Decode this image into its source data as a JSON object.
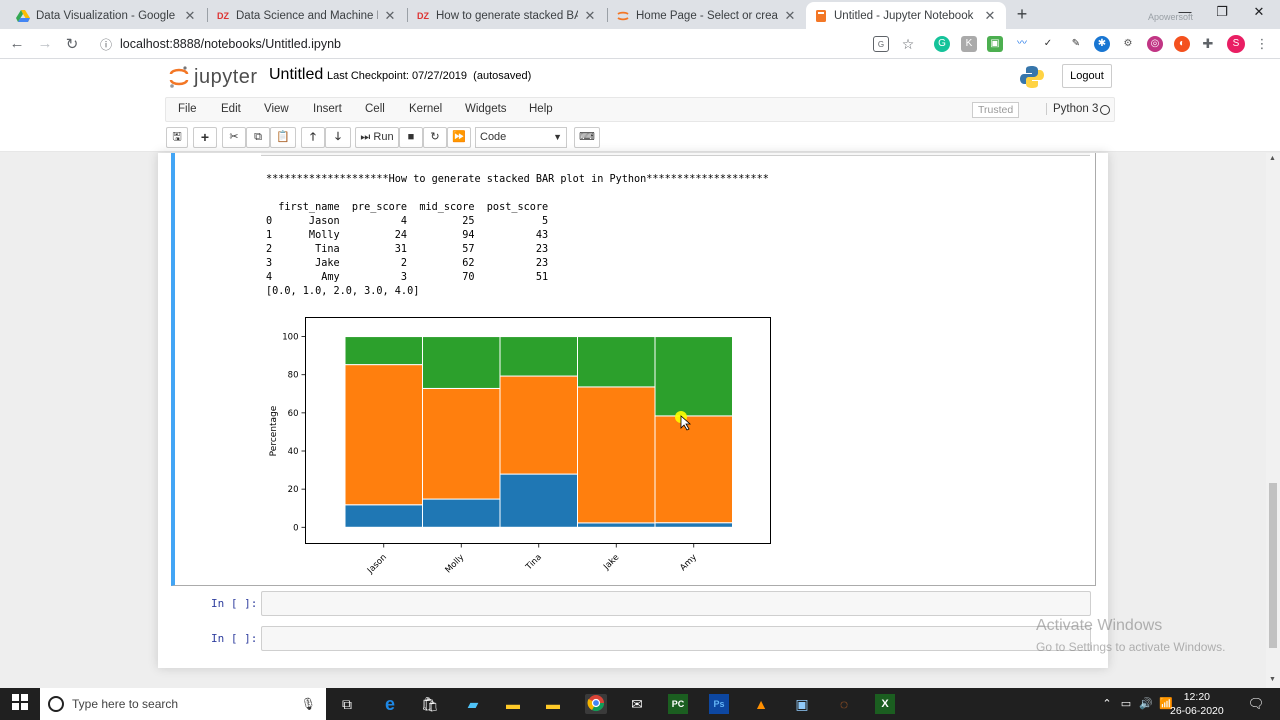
{
  "browser": {
    "tabs": [
      {
        "title": "Data Visualization - Google Drive",
        "favicon": "drive-icon"
      },
      {
        "title": "Data Science and Machine Learn",
        "favicon": "dz-icon"
      },
      {
        "title": "How to generate stacked BAR plo",
        "favicon": "dz-icon"
      },
      {
        "title": "Home Page - Select or create a n",
        "favicon": "jupyter-icon"
      },
      {
        "title": "Untitled - Jupyter Notebook",
        "favicon": "jupyter-book-icon"
      }
    ],
    "url": "localhost:8888/notebooks/Untitled.ipynb",
    "apowersoft": "Apowersoft"
  },
  "jupyter": {
    "logo_text": "jupyter",
    "notebook_name": "Untitled",
    "checkpoint": "Last Checkpoint: 07/27/2019",
    "autosaved": "(autosaved)",
    "logout": "Logout",
    "menu": [
      "File",
      "Edit",
      "View",
      "Insert",
      "Cell",
      "Kernel",
      "Widgets",
      "Help"
    ],
    "trusted": "Trusted",
    "kernel": "Python 3",
    "run_label": "Run",
    "cell_type": "Code"
  },
  "output": {
    "header": "********************How to generate stacked BAR plot in Python********************",
    "table_columns": [
      "first_name",
      "pre_score",
      "mid_score",
      "post_score"
    ],
    "table_rows": [
      [
        "0",
        "Jason",
        "4",
        "25",
        "5"
      ],
      [
        "1",
        "Molly",
        "24",
        "94",
        "43"
      ],
      [
        "2",
        "Tina",
        "31",
        "57",
        "23"
      ],
      [
        "3",
        "Jake",
        "2",
        "62",
        "23"
      ],
      [
        "4",
        "Amy",
        "3",
        "70",
        "51"
      ]
    ],
    "list_line": "[0.0, 1.0, 2.0, 3.0, 4.0]"
  },
  "chart_data": {
    "type": "bar",
    "stacked": true,
    "categories": [
      "Jason",
      "Molly",
      "Tina",
      "Jake",
      "Amy"
    ],
    "series": [
      {
        "values": [
          11.8,
          14.8,
          27.9,
          2.3,
          2.4
        ],
        "color": "#1f77b4"
      },
      {
        "values": [
          73.5,
          58.0,
          51.4,
          71.3,
          56.0
        ],
        "color": "#ff7f0e"
      },
      {
        "values": [
          14.7,
          27.2,
          20.7,
          26.4,
          41.6
        ],
        "color": "#2ca02c"
      }
    ],
    "ylabel": "Percentage",
    "yticks": [
      0,
      20,
      40,
      60,
      80,
      100
    ],
    "ylim": [
      -8.5,
      110
    ],
    "grid": false,
    "legend": false
  },
  "prompts": [
    "In [ ]:",
    "In [ ]:"
  ],
  "watermark": {
    "line1": "Activate Windows",
    "line2": "Go to Settings to activate Windows."
  },
  "taskbar": {
    "search_placeholder": "Type here to search",
    "time": "12:20",
    "date": "26-06-2020"
  }
}
